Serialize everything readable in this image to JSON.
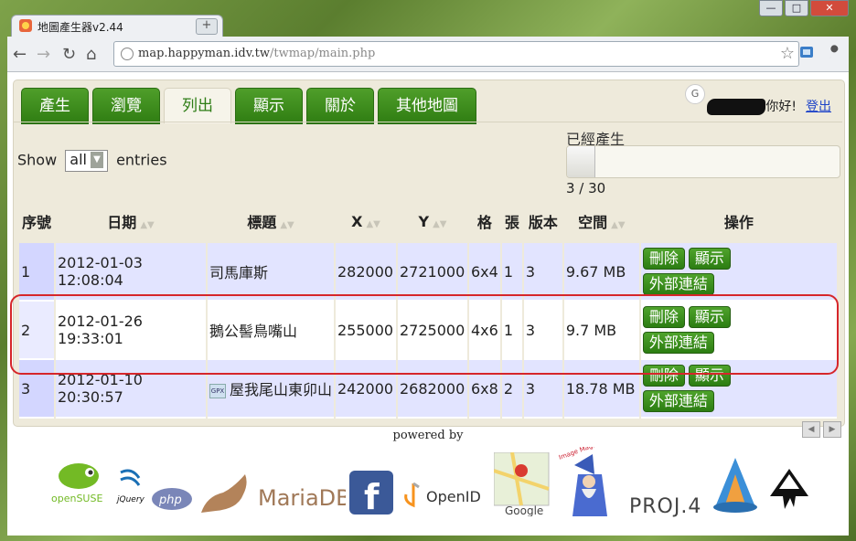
{
  "browser": {
    "tab_title": "地圖產生器v2.44",
    "tab_close": "×",
    "new_tab": "+",
    "window_buttons": [
      "—",
      "□",
      "✕"
    ],
    "nav": {
      "back": "←",
      "forward": "→",
      "reload": "↻",
      "home": "⌂"
    },
    "url_host": "map.happyman.idv.tw",
    "url_path": "/twmap/main.php",
    "star": "☆"
  },
  "app": {
    "tabs": [
      "產生",
      "瀏覽",
      "列出",
      "顯示",
      "關於",
      "其他地圖"
    ],
    "active_tab_index": 2,
    "greeting": "你好!",
    "logout": "登出",
    "show_label": "Show",
    "entries_select": "all",
    "entries_label": "entries",
    "progress_label": "已經產生",
    "progress_count": "3 / 30",
    "progress_fraction": 0.1
  },
  "table": {
    "headers": [
      "序號",
      "日期",
      "標題",
      "X",
      "Y",
      "格",
      "張",
      "版本",
      "空間",
      "操作"
    ],
    "rows": [
      {
        "no": "1",
        "date": "2012-01-03",
        "time": "12:08:04",
        "title": "司馬庫斯",
        "x": "282000",
        "y": "2721000",
        "grid": "6x4",
        "sheets": "1",
        "ver": "3",
        "size": "9.67 MB"
      },
      {
        "no": "2",
        "date": "2012-01-26",
        "time": "19:33:01",
        "title": "鵝公髻鳥嘴山",
        "x": "255000",
        "y": "2725000",
        "grid": "4x6",
        "sheets": "1",
        "ver": "3",
        "size": "9.7 MB"
      },
      {
        "no": "3",
        "date": "2012-01-10",
        "time": "20:30:57",
        "title": "屋我尾山東卯山",
        "x": "242000",
        "y": "2682000",
        "grid": "6x8",
        "sheets": "2",
        "ver": "3",
        "size": "18.78 MB"
      }
    ],
    "btn_delete": "刪除",
    "btn_show": "顯示",
    "btn_link": "外部連結",
    "gpx_badge": "GPX"
  },
  "footer": {
    "powered_by": "powered by",
    "logos": [
      "openSUSE",
      "jQuery",
      "php",
      "MariaDB",
      "f",
      "OpenID",
      "Google",
      "Image Magick",
      "PROJ.4"
    ]
  }
}
